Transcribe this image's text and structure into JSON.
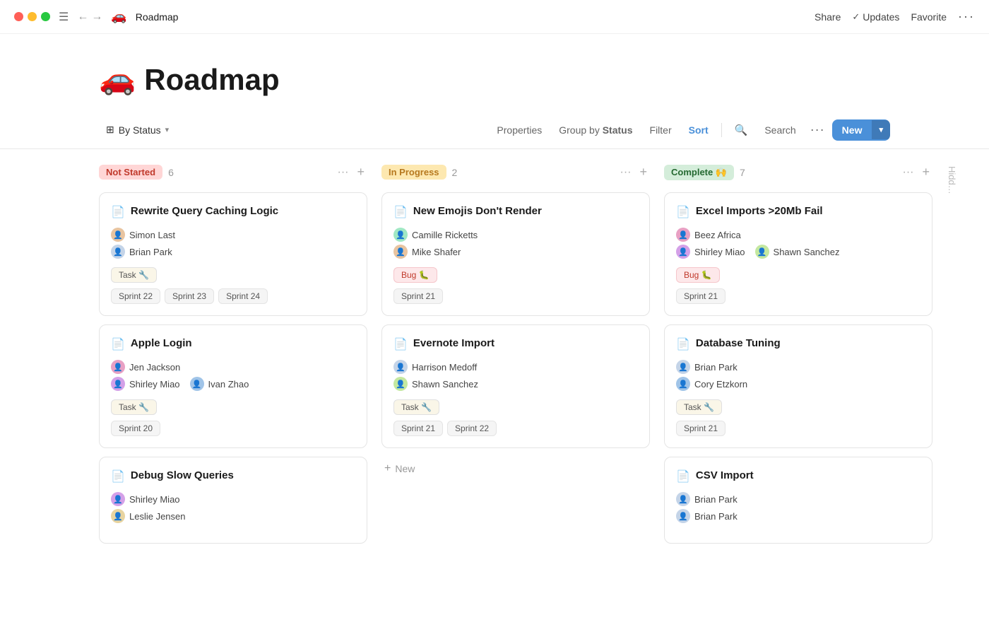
{
  "titlebar": {
    "page_icon": "🚗",
    "page_name": "Roadmap",
    "share": "Share",
    "updates": "Updates",
    "favorite": "Favorite"
  },
  "header": {
    "emoji": "🚗",
    "title": "Roadmap"
  },
  "toolbar": {
    "by_status": "By Status",
    "properties": "Properties",
    "group_by_prefix": "Group by",
    "group_by_value": "Status",
    "filter": "Filter",
    "sort": "Sort",
    "search": "Search",
    "new_label": "New"
  },
  "columns": [
    {
      "id": "not-started",
      "status": "Not Started",
      "badge_class": "not-started",
      "count": 6,
      "cards": [
        {
          "title": "Rewrite Query Caching Logic",
          "people": [
            {
              "name": "Simon Last",
              "av": "av-1"
            },
            {
              "name": "Brian Park",
              "av": "av-2"
            }
          ],
          "tag": "Task 🔧",
          "tag_class": "",
          "sprints": [
            "Sprint 22",
            "Sprint 23",
            "Sprint 24"
          ]
        },
        {
          "title": "Apple Login",
          "people": [
            {
              "name": "Jen Jackson",
              "av": "av-3"
            },
            {
              "name": "Shirley Miao",
              "av": "av-5",
              "extra_name": "Ivan Zhao",
              "extra_av": "av-6"
            }
          ],
          "tag": "Task 🔧",
          "tag_class": "",
          "sprints": [
            "Sprint 20"
          ]
        },
        {
          "title": "Debug Slow Queries",
          "people": [
            {
              "name": "Shirley Miao",
              "av": "av-5"
            },
            {
              "name": "Leslie Jensen",
              "av": "av-7"
            }
          ],
          "tag": "",
          "sprints": []
        }
      ]
    },
    {
      "id": "in-progress",
      "status": "In Progress",
      "badge_class": "in-progress",
      "count": 2,
      "cards": [
        {
          "title": "New Emojis Don't Render",
          "people": [
            {
              "name": "Camille Ricketts",
              "av": "av-4"
            },
            {
              "name": "Mike Shafer",
              "av": "av-1"
            }
          ],
          "tag": "Bug 🐛",
          "tag_class": "bug",
          "sprints": [
            "Sprint 21"
          ]
        },
        {
          "title": "Evernote Import",
          "people": [
            {
              "name": "Harrison Medoff",
              "av": "av-2"
            },
            {
              "name": "Shawn Sanchez",
              "av": "av-8"
            }
          ],
          "tag": "Task 🔧",
          "tag_class": "",
          "sprints": [
            "Sprint 21",
            "Sprint 22"
          ]
        }
      ],
      "new_card": true
    },
    {
      "id": "complete",
      "status": "Complete 🙌",
      "badge_class": "complete",
      "count": 7,
      "cards": [
        {
          "title": "Excel Imports >20Mb Fail",
          "people": [
            {
              "name": "Beez Africa",
              "av": "av-3"
            },
            {
              "name": "Shirley Miao",
              "av": "av-5",
              "extra_name": "Shawn Sanchez",
              "extra_av": "av-8"
            }
          ],
          "tag": "Bug 🐛",
          "tag_class": "bug",
          "sprints": [
            "Sprint 21"
          ]
        },
        {
          "title": "Database Tuning",
          "people": [
            {
              "name": "Brian Park",
              "av": "av-2"
            },
            {
              "name": "Cory Etzkorn",
              "av": "av-6"
            }
          ],
          "tag": "Task 🔧",
          "tag_class": "",
          "sprints": [
            "Sprint 21"
          ]
        },
        {
          "title": "CSV Import",
          "people": [
            {
              "name": "Brian Park",
              "av": "av-2"
            },
            {
              "name": "Brian Park",
              "av": "av-2"
            }
          ],
          "tag": "",
          "sprints": []
        }
      ]
    }
  ],
  "hidden_col": {
    "label": "Hidden"
  }
}
